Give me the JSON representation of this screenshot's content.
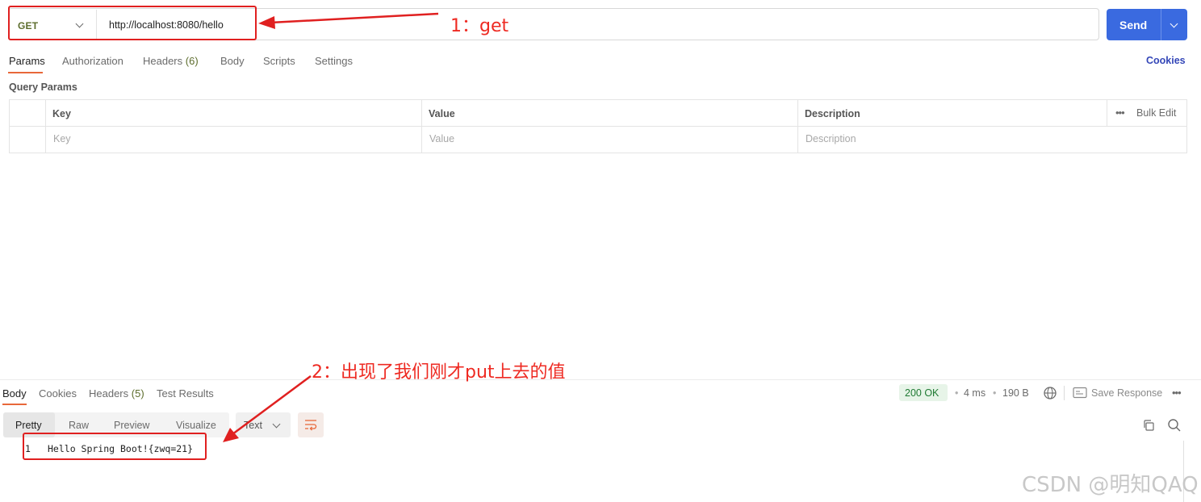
{
  "request": {
    "method": "GET",
    "url": "http://localhost:8080/hello",
    "send_label": "Send"
  },
  "tabs": [
    {
      "label": "Params"
    },
    {
      "label": "Authorization"
    },
    {
      "label": "Headers"
    },
    {
      "label": "Body"
    },
    {
      "label": "Scripts"
    },
    {
      "label": "Settings"
    }
  ],
  "headers_count": "(6)",
  "cookies_link": "Cookies",
  "query_params": {
    "title": "Query Params",
    "columns": [
      "Key",
      "Value",
      "Description"
    ],
    "bulk_edit": "Bulk Edit",
    "placeholders": [
      "Key",
      "Value",
      "Description"
    ]
  },
  "response": {
    "tabs": [
      {
        "label": "Body"
      },
      {
        "label": "Cookies"
      },
      {
        "label": "Headers"
      },
      {
        "label": "Test Results"
      }
    ],
    "headers_count": "(5)",
    "status": "200 OK",
    "time": "4 ms",
    "size": "190 B",
    "save_response": "Save Response",
    "view_modes": [
      "Pretty",
      "Raw",
      "Preview",
      "Visualize"
    ],
    "format": "Text",
    "line_number": "1",
    "body_line": "Hello Spring Boot!{zwq=21}"
  },
  "annotations": {
    "note1": "1：get",
    "note2": "2：出现了我们刚才put上去的值"
  },
  "watermark": "CSDN @明知QAQ",
  "colors": {
    "accent": "#e8683a",
    "send_button": "#3a6ae0",
    "annotation_red": "#e02020",
    "status_green": "#1f7a33"
  }
}
